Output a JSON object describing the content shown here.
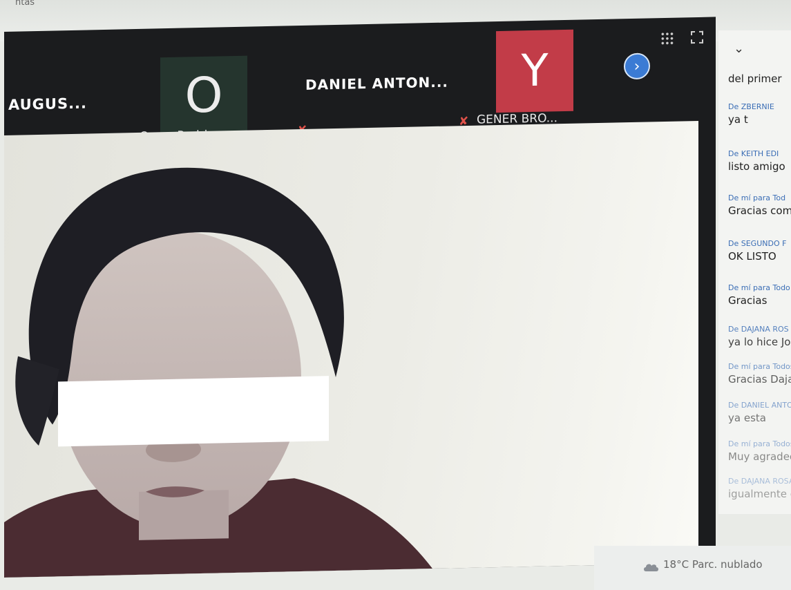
{
  "window": {
    "title_fragment": "ntas"
  },
  "participants": [
    {
      "name": "AUGUS...",
      "mic_muted": false
    },
    {
      "avatar_letter": "O",
      "name": "Oscar Rodri...",
      "mic_muted": true
    },
    {
      "name": "DANIEL ANTON...",
      "mic_muted": true
    },
    {
      "avatar_letter": "Y",
      "name": "GENER BRO...",
      "mic_muted": true
    }
  ],
  "controls": {
    "next_icon": "chevron-right-icon",
    "grid_icon": "grid-icon",
    "fullscreen_icon": "fullscreen-icon"
  },
  "chat": {
    "collapse_icon": "chevron-down-icon",
    "messages": [
      {
        "from": "",
        "text": "del primer"
      },
      {
        "from": "De ZBERNIE",
        "text": "ya t"
      },
      {
        "from": "De KEITH EDI",
        "text": "listo amigo"
      },
      {
        "from": "De mí para Tod",
        "text": "Gracias comp"
      },
      {
        "from": "De SEGUNDO F",
        "text": "OK LISTO"
      },
      {
        "from": "De mí para Todo",
        "text": "Gracias"
      },
      {
        "from": "De DAJANA ROS",
        "text": "ya lo hice Jose"
      },
      {
        "from": "De mí para Todos",
        "text": "Gracias Dajana"
      },
      {
        "from": "De DANIEL ANTON",
        "text": "ya esta"
      },
      {
        "from": "De mí para Todos",
        "text": "Muy agradecido"
      },
      {
        "from": "De DAJANA ROSAL",
        "text": "igualmente comp"
      }
    ]
  },
  "taskbar": {
    "weather": "18°C  Parc. nublado"
  },
  "colors": {
    "avatar_o_bg": "#25352e",
    "avatar_y_bg": "#c23c48",
    "accent_blue": "#3b7bd4",
    "muted_mic": "#e0524a"
  }
}
